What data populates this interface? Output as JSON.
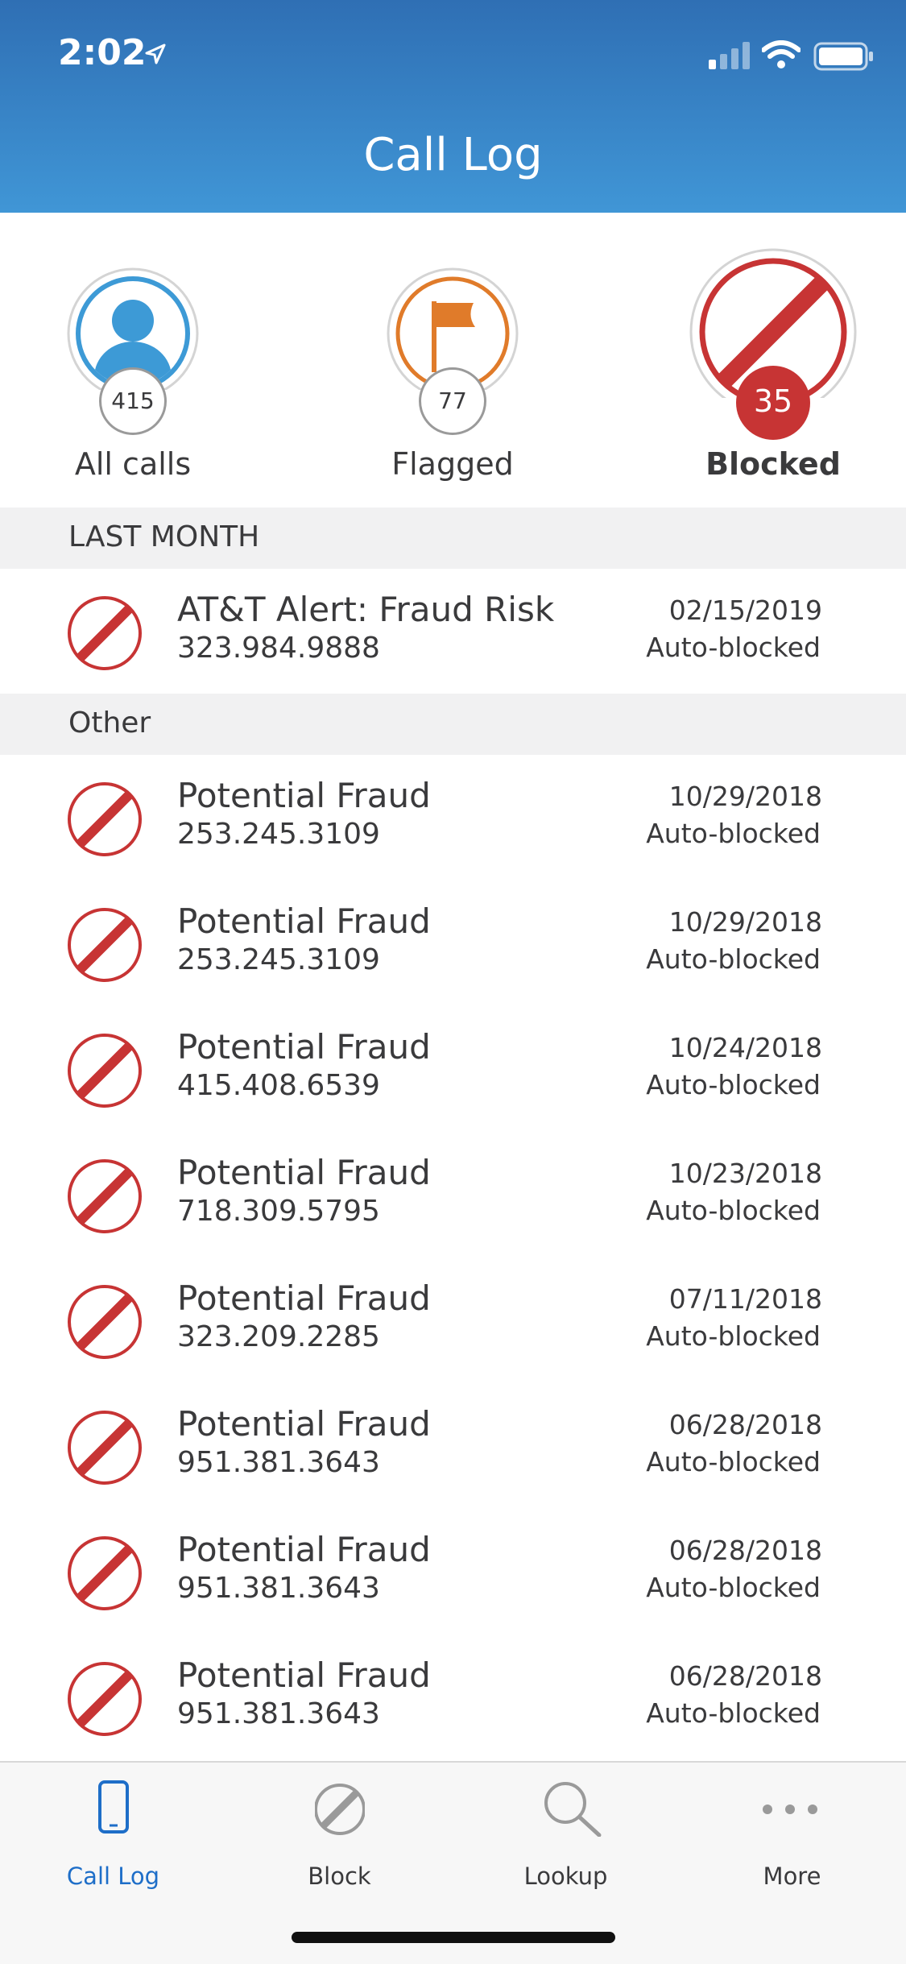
{
  "status_bar": {
    "time": "2:02"
  },
  "header": {
    "title": "Call Log"
  },
  "filters": [
    {
      "label": "All calls",
      "count": "415"
    },
    {
      "label": "Flagged",
      "count": "77"
    },
    {
      "label": "Blocked",
      "count": "35"
    }
  ],
  "sections": [
    {
      "title": "LAST MONTH",
      "rows": [
        {
          "name": "AT&T Alert: Fraud Risk",
          "phone": "323.984.9888",
          "date": "02/15/2019",
          "status": "Auto-blocked"
        }
      ]
    },
    {
      "title": "Other",
      "rows": [
        {
          "name": "Potential Fraud",
          "phone": "253.245.3109",
          "date": "10/29/2018",
          "status": "Auto-blocked"
        },
        {
          "name": "Potential Fraud",
          "phone": "253.245.3109",
          "date": "10/29/2018",
          "status": "Auto-blocked"
        },
        {
          "name": "Potential Fraud",
          "phone": "415.408.6539",
          "date": "10/24/2018",
          "status": "Auto-blocked"
        },
        {
          "name": "Potential Fraud",
          "phone": "718.309.5795",
          "date": "10/23/2018",
          "status": "Auto-blocked"
        },
        {
          "name": "Potential Fraud",
          "phone": "323.209.2285",
          "date": "07/11/2018",
          "status": "Auto-blocked"
        },
        {
          "name": "Potential Fraud",
          "phone": "951.381.3643",
          "date": "06/28/2018",
          "status": "Auto-blocked"
        },
        {
          "name": "Potential Fraud",
          "phone": "951.381.3643",
          "date": "06/28/2018",
          "status": "Auto-blocked"
        },
        {
          "name": "Potential Fraud",
          "phone": "951.381.3643",
          "date": "06/28/2018",
          "status": "Auto-blocked"
        }
      ]
    }
  ],
  "tabbar": {
    "tabs": [
      {
        "label": "Call Log",
        "icon": "phone-icon"
      },
      {
        "label": "Block",
        "icon": "block-icon"
      },
      {
        "label": "Lookup",
        "icon": "search-icon"
      },
      {
        "label": "More",
        "icon": "more-icon"
      }
    ]
  },
  "colors": {
    "header_top": "#2f6fb4",
    "header_bottom": "#4096d6",
    "blocked_red": "#c73434",
    "flag_orange": "#e07b2a",
    "all_calls_blue": "#3d9ad6",
    "active_tab": "#1e6ec8"
  }
}
